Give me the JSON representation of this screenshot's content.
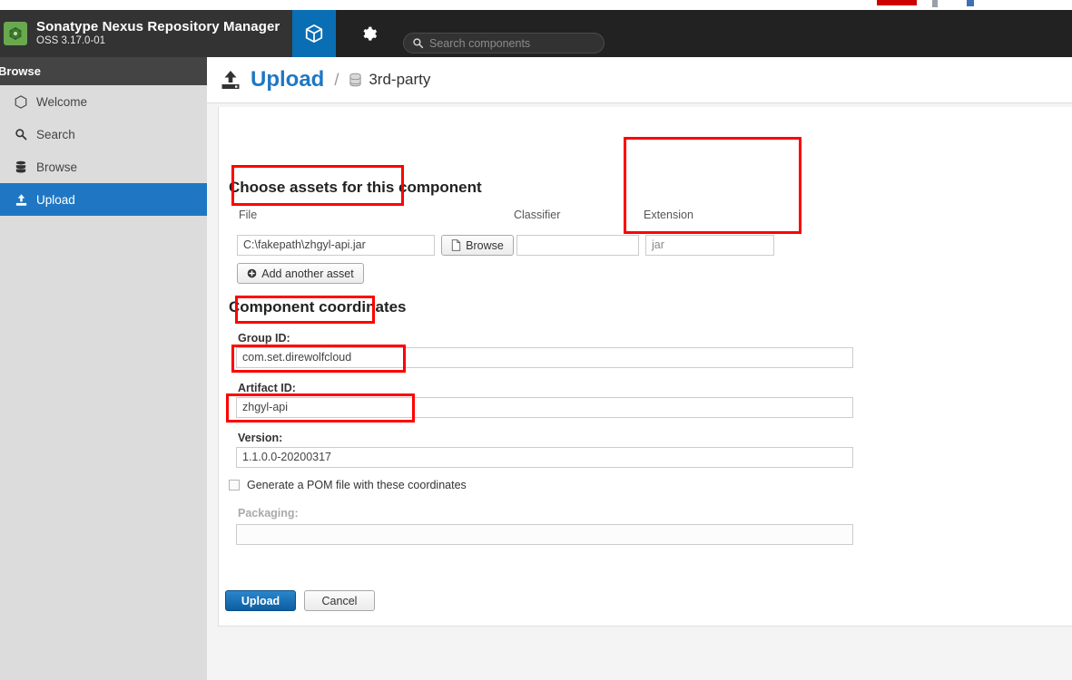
{
  "header": {
    "brand_title": "Sonatype Nexus Repository Manager",
    "brand_version": "OSS 3.17.0-01",
    "logo_icon": "nexus-cube-logo",
    "tab_icon": "box-icon",
    "gear_icon": "gear-icon",
    "search": {
      "icon": "search-icon",
      "placeholder": "Search components",
      "value": ""
    }
  },
  "sidebar": {
    "section_label": "Browse",
    "items": [
      {
        "label": "Welcome",
        "icon": "hexagon-icon",
        "active": false
      },
      {
        "label": "Search",
        "icon": "search-icon",
        "active": false
      },
      {
        "label": "Browse",
        "icon": "database-icon",
        "active": false
      },
      {
        "label": "Upload",
        "icon": "upload-icon",
        "active": true
      }
    ]
  },
  "page": {
    "icon": "upload-icon",
    "title": "Upload",
    "separator": "/",
    "repo_icon": "database-icon",
    "repository": "3rd-party"
  },
  "assets": {
    "section_title": "Choose assets for this component",
    "file": {
      "label": "File",
      "value": "C:\\fakepath\\zhgyl-api.jar"
    },
    "browse_button": {
      "label": "Browse",
      "icon": "file-icon"
    },
    "classifier": {
      "label": "Classifier",
      "value": ""
    },
    "extension": {
      "label": "Extension",
      "value": "jar"
    },
    "add_asset_button": {
      "label": "Add another asset",
      "icon": "plus-circle-icon"
    }
  },
  "coordinates": {
    "section_title": "Component coordinates",
    "group_id": {
      "label": "Group ID:",
      "value": "com.set.direwolfcloud"
    },
    "artifact_id": {
      "label": "Artifact ID:",
      "value": "zhgyl-api"
    },
    "version": {
      "label": "Version:",
      "value": "1.1.0.0-20200317"
    },
    "generate_pom": {
      "label": "Generate a POM file with these coordinates",
      "checked": false
    },
    "packaging": {
      "label": "Packaging:",
      "value": ""
    }
  },
  "actions": {
    "upload_label": "Upload",
    "cancel_label": "Cancel"
  },
  "colors": {
    "accent_blue": "#1f77c4",
    "header_dark": "#222222",
    "annotation_red": "#fe0000",
    "sidebar_grey": "#dcdcdc"
  }
}
